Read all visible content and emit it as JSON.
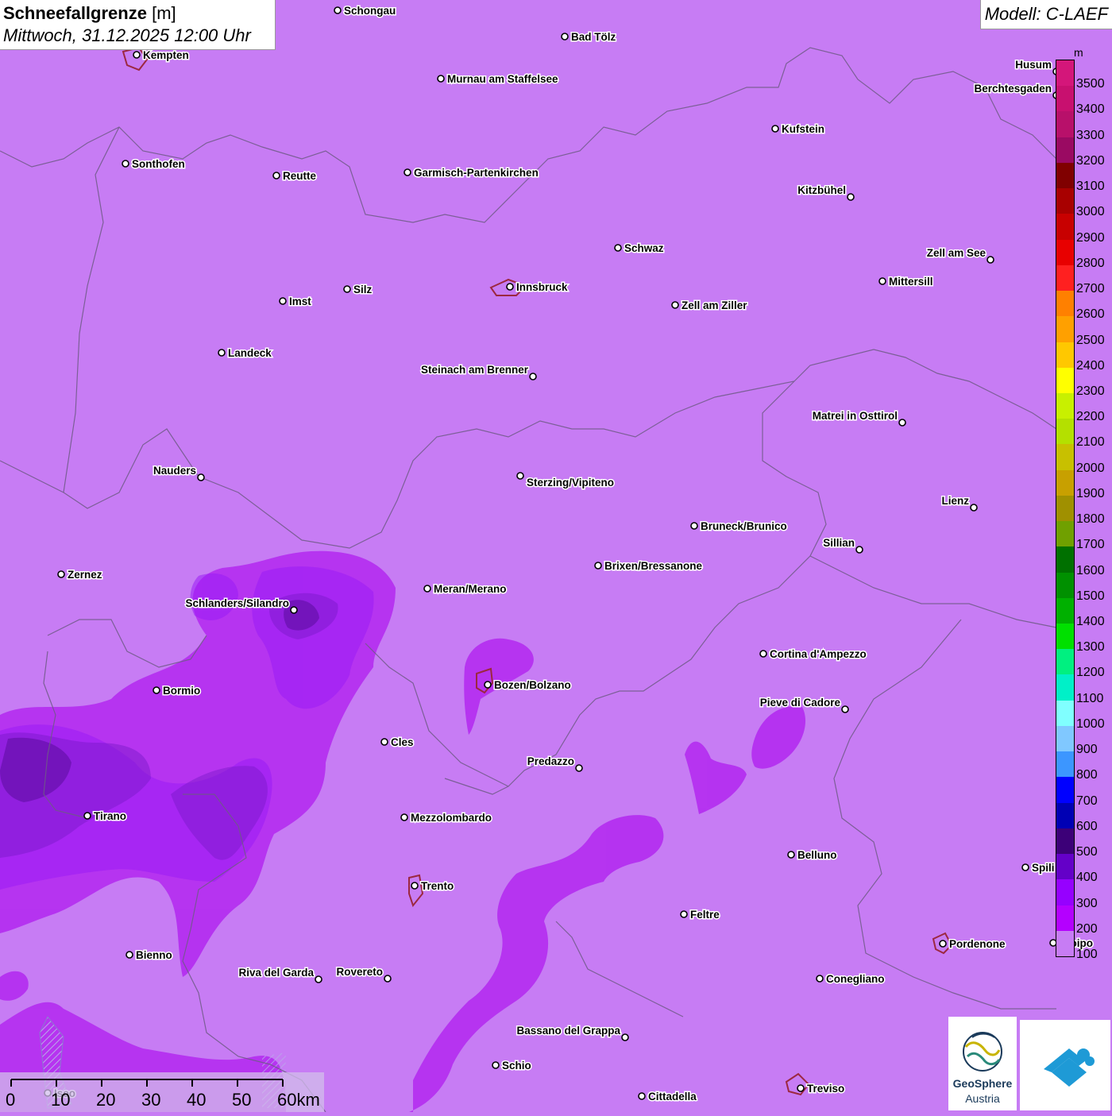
{
  "title": {
    "main": "Schneefallgrenze",
    "unit": "[m]",
    "datetime": "Mittwoch, 31.12.2025 12:00 Uhr"
  },
  "model": "Modell: C-LAEF",
  "legend": {
    "unit": "m",
    "levels": [
      {
        "label": "3500",
        "color": "#d4167a"
      },
      {
        "label": "3400",
        "color": "#c8106f"
      },
      {
        "label": "3300",
        "color": "#b8106a"
      },
      {
        "label": "3200",
        "color": "#9a0a62"
      },
      {
        "label": "3100",
        "color": "#800000"
      },
      {
        "label": "3000",
        "color": "#a80000"
      },
      {
        "label": "2900",
        "color": "#c80000"
      },
      {
        "label": "2800",
        "color": "#e80000"
      },
      {
        "label": "2700",
        "color": "#ff2020"
      },
      {
        "label": "2600",
        "color": "#ff8000"
      },
      {
        "label": "2500",
        "color": "#ffa000"
      },
      {
        "label": "2400",
        "color": "#ffc800"
      },
      {
        "label": "2300",
        "color": "#ffff00"
      },
      {
        "label": "2200",
        "color": "#c8f000"
      },
      {
        "label": "2100",
        "color": "#b4e000"
      },
      {
        "label": "2000",
        "color": "#c8c000"
      },
      {
        "label": "1900",
        "color": "#c8a000"
      },
      {
        "label": "1800",
        "color": "#a09000"
      },
      {
        "label": "1700",
        "color": "#70a000"
      },
      {
        "label": "1600",
        "color": "#007000"
      },
      {
        "label": "1500",
        "color": "#009000"
      },
      {
        "label": "1400",
        "color": "#00b000"
      },
      {
        "label": "1300",
        "color": "#00e000"
      },
      {
        "label": "1200",
        "color": "#00f080"
      },
      {
        "label": "1100",
        "color": "#00f0c8"
      },
      {
        "label": "1000",
        "color": "#80ffff"
      },
      {
        "label": "900",
        "color": "#80c8ff"
      },
      {
        "label": "800",
        "color": "#3c96ff"
      },
      {
        "label": "700",
        "color": "#0000ff"
      },
      {
        "label": "600",
        "color": "#0000b4"
      },
      {
        "label": "500",
        "color": "#3c0078"
      },
      {
        "label": "400",
        "color": "#6400c8"
      },
      {
        "label": "300",
        "color": "#9600ff"
      },
      {
        "label": "200",
        "color": "#b400ff"
      },
      {
        "label": "100",
        "color": "#c77cf4"
      }
    ]
  },
  "cities": [
    "Schongau",
    "Bad Tölz",
    "Kempten",
    "Murnau am Staffelsee",
    "Berchtesgaden",
    "Kufstein",
    "Sonthofen",
    "Reutte",
    "Garmisch-Partenkirchen",
    "Kitzbühel",
    "Schwaz",
    "Zell am See",
    "Innsbruck",
    "Mittersill",
    "Imst",
    "Silz",
    "Zell am Ziller",
    "Landeck",
    "Steinach am Brenner",
    "Matrei in Osttirol",
    "Nauders",
    "Sterzing/Vipiteno",
    "Lienz",
    "Bruneck/Brunico",
    "Sillian",
    "Zernez",
    "Brixen/Bressanone",
    "Meran/Merano",
    "Schlanders/Silandro",
    "Cortina d'Ampezzo",
    "Bozen/Bolzano",
    "Bormio",
    "Pieve di Cadore",
    "Cles",
    "Predazzo",
    "Tirano",
    "Mezzolombardo",
    "Belluno",
    "Spili",
    "Trento",
    "Feltre",
    "Pordenone",
    "Bienno",
    "Riva del Garda",
    "Rovereto",
    "Conegliano",
    "Bassano del Grappa",
    "Schio",
    "Treviso",
    "Cittadella",
    "Iseo",
    "droipo",
    "Husum"
  ],
  "scale": {
    "labels": [
      "0",
      "10",
      "20",
      "30",
      "40",
      "50",
      "60km"
    ]
  },
  "logo": {
    "name": "GeoSphere",
    "sub": "Austria"
  }
}
